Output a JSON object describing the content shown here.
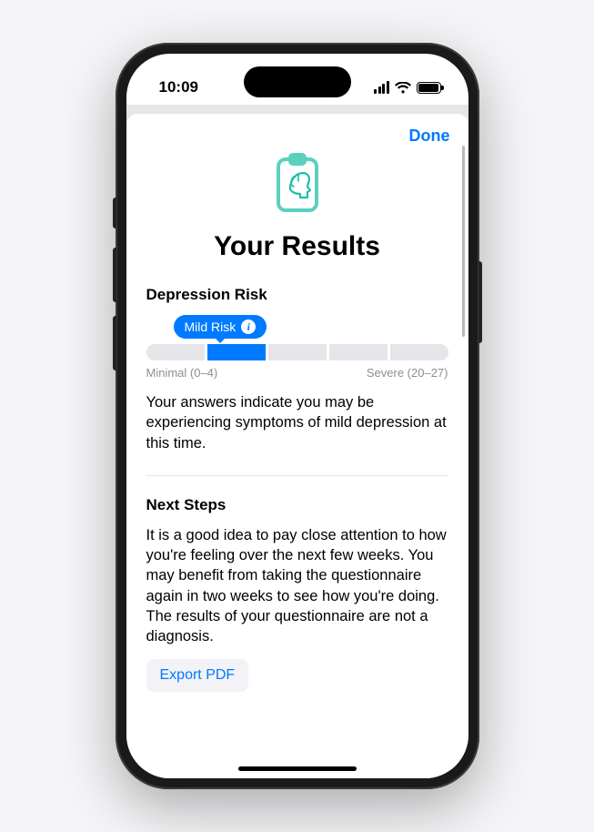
{
  "status": {
    "time": "10:09"
  },
  "sheet": {
    "done": "Done",
    "title": "Your Results",
    "risk": {
      "section_label": "Depression Risk",
      "bubble": "Mild Risk",
      "active_segment": 1,
      "total_segments": 5,
      "low_label": "Minimal (0–4)",
      "high_label": "Severe (20–27)",
      "summary": "Your answers indicate you may be experiencing symptoms of mild depression at this time."
    },
    "next_steps": {
      "heading": "Next Steps",
      "body": "It is a good idea to pay close attention to how you're feeling over the next few weeks. You may benefit from taking the questionnaire again in two weeks to see how you're doing. The results of your questionnaire are not a diagnosis."
    },
    "export_label": "Export PDF"
  }
}
